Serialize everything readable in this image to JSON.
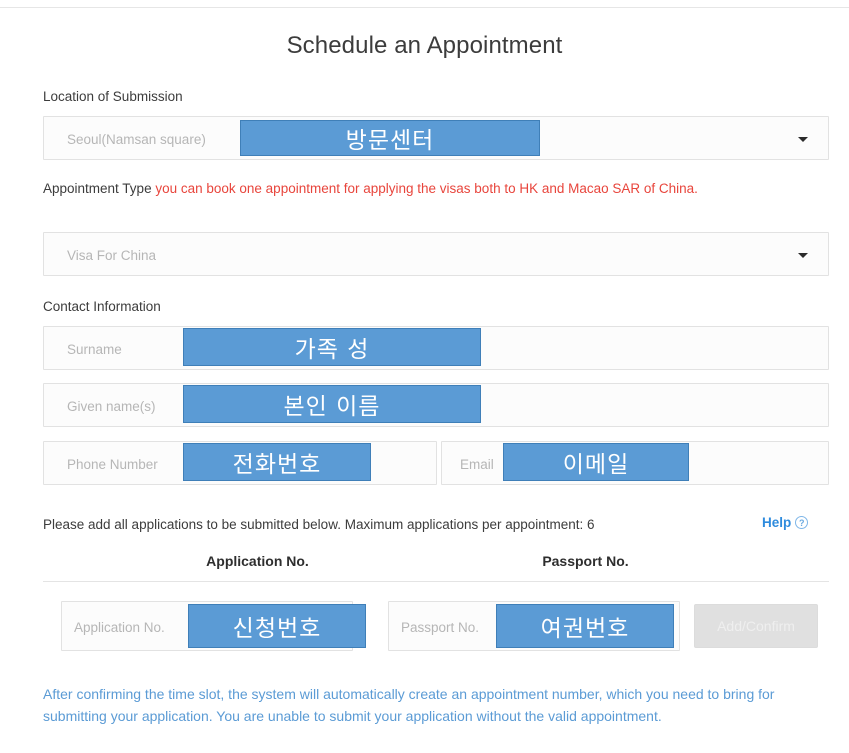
{
  "page": {
    "title": "Schedule an Appointment"
  },
  "location_section": {
    "label": "Location of Submission",
    "select_value": "Seoul(Namsan square)",
    "caret_icon": "chevron-down-icon",
    "overlay": "방문센터"
  },
  "appointment_type_section": {
    "label": "Appointment Type",
    "hint": "you can book one appointment for applying the visas both to HK and Macao SAR of China.",
    "select_value": "Visa For China",
    "caret_icon": "chevron-down-icon"
  },
  "contact_section": {
    "label": "Contact Information",
    "fields": [
      {
        "placeholder": "Surname",
        "overlay": "가족 성"
      },
      {
        "placeholder": "Given name(s)",
        "overlay": "본인 이름"
      },
      {
        "placeholder": "Phone Number",
        "overlay": "전화번호"
      },
      {
        "placeholder": "Email",
        "overlay": "이메일"
      }
    ]
  },
  "applications_section": {
    "instruction": "Please add all applications to be submitted below. Maximum applications per appointment: 6",
    "help_label": "Help",
    "help_icon": "question-circle-icon",
    "columns": [
      "Application No.",
      "Passport No."
    ],
    "row": {
      "application_placeholder": "Application No.",
      "application_overlay": "신청번호",
      "passport_placeholder": "Passport No.",
      "passport_overlay": "여권번호",
      "add_button_label": "Add/Confirm"
    }
  },
  "footer": {
    "notice": "After confirming the time slot, the system will automatically create an appointment number, which you need to bring for submitting your application. You are unable to submit your application without the valid appointment."
  },
  "colors": {
    "overlay_blue": "#5b9bd5",
    "hint_red": "#e8453c",
    "link_blue": "#2e8bdd",
    "notice_blue": "#5b9bd5"
  }
}
